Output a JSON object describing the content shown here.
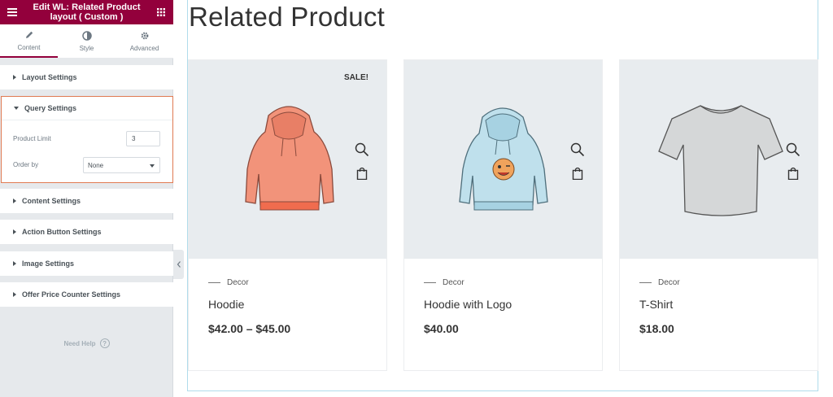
{
  "panel": {
    "title": "Edit WL: Related Product layout ( Custom )",
    "tabs": [
      {
        "label": "Content",
        "icon": "pencil-icon"
      },
      {
        "label": "Style",
        "icon": "half-circle-icon"
      },
      {
        "label": "Advanced",
        "icon": "gear-icon"
      }
    ],
    "active_tab": "Content",
    "sections": [
      {
        "label": "Layout Settings"
      },
      {
        "label": "Query Settings"
      },
      {
        "label": "Content Settings"
      },
      {
        "label": "Action Button Settings"
      },
      {
        "label": "Image Settings"
      },
      {
        "label": "Offer Price Counter Settings"
      }
    ],
    "query": {
      "product_limit_label": "Product Limit",
      "product_limit_value": "3",
      "order_by_label": "Order by",
      "order_by_value": "None"
    },
    "need_help": "Need Help",
    "help_icon": "?"
  },
  "preview": {
    "title": "Related Product",
    "products": [
      {
        "name": "Hoodie",
        "category": "Decor",
        "price": "$42.00 – $45.00",
        "badge": "SALE!",
        "image": "coral-hoodie"
      },
      {
        "name": "Hoodie with Logo",
        "category": "Decor",
        "price": "$40.00",
        "badge": "",
        "image": "blue-hoodie-with-logo"
      },
      {
        "name": "T-Shirt",
        "category": "Decor",
        "price": "$18.00",
        "badge": "",
        "image": "grey-tshirt"
      }
    ]
  },
  "colors": {
    "brand": "#93003c",
    "highlight_border": "#e07a52",
    "preview_border": "#b0dceb",
    "product_bg": "#e8ecef"
  }
}
